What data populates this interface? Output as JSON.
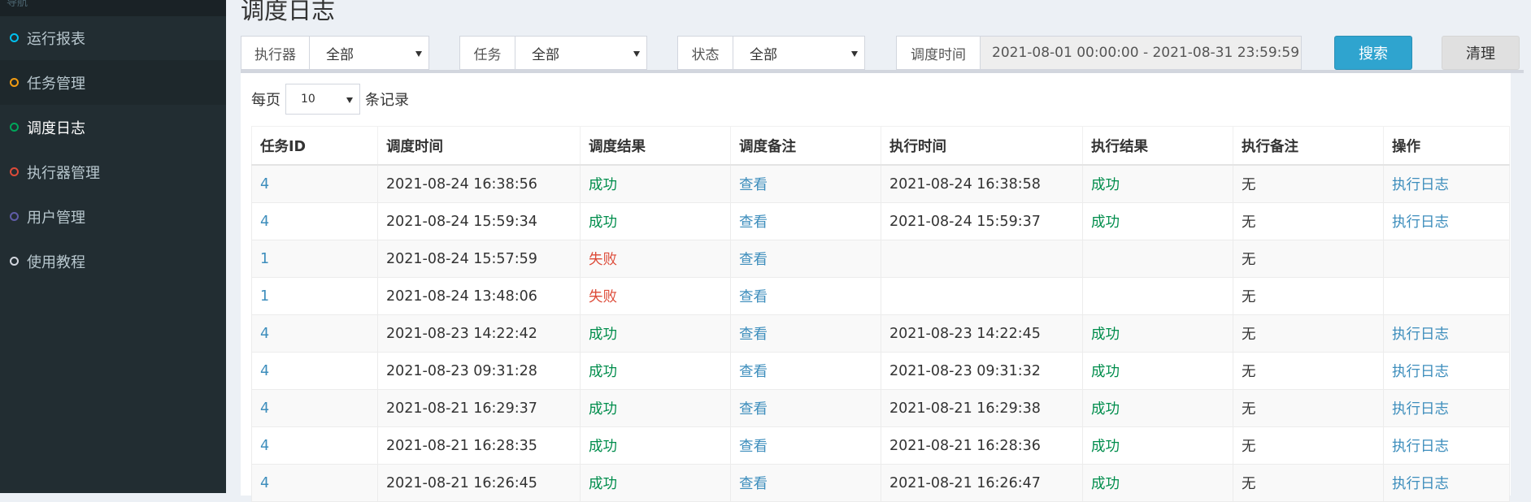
{
  "sidebar": {
    "top_label": "导航",
    "items": [
      {
        "label": "运行报表",
        "color": "#00c0ef"
      },
      {
        "label": "任务管理",
        "color": "#f39c12"
      },
      {
        "label": "调度日志",
        "color": "#00a65a"
      },
      {
        "label": "执行器管理",
        "color": "#dd4b39"
      },
      {
        "label": "用户管理",
        "color": "#605ca8"
      },
      {
        "label": "使用教程",
        "color": "#d2d6de"
      }
    ]
  },
  "page": {
    "title": "调度日志"
  },
  "filters": {
    "executor": {
      "label": "执行器",
      "value": "全部"
    },
    "task": {
      "label": "任务",
      "value": "全部"
    },
    "status": {
      "label": "状态",
      "value": "全部"
    },
    "time": {
      "label": "调度时间",
      "value": "2021-08-01 00:00:00 - 2021-08-31 23:59:59"
    },
    "search_label": "搜索",
    "clear_label": "清理"
  },
  "per_page": {
    "prefix": "每页",
    "value": "10",
    "suffix": "条记录"
  },
  "table": {
    "headers": [
      "任务ID",
      "调度时间",
      "调度结果",
      "调度备注",
      "执行时间",
      "执行结果",
      "执行备注",
      "操作"
    ],
    "rows": [
      [
        "4",
        "2021-08-24 16:38:56",
        "成功",
        "查看",
        "2021-08-24 16:38:58",
        "成功",
        "无",
        "执行日志"
      ],
      [
        "4",
        "2021-08-24 15:59:34",
        "成功",
        "查看",
        "2021-08-24 15:59:37",
        "成功",
        "无",
        "执行日志"
      ],
      [
        "1",
        "2021-08-24 15:57:59",
        "失败",
        "查看",
        "",
        "",
        "无",
        ""
      ],
      [
        "1",
        "2021-08-24 13:48:06",
        "失败",
        "查看",
        "",
        "",
        "无",
        ""
      ],
      [
        "4",
        "2021-08-23 14:22:42",
        "成功",
        "查看",
        "2021-08-23 14:22:45",
        "成功",
        "无",
        "执行日志"
      ],
      [
        "4",
        "2021-08-23 09:31:28",
        "成功",
        "查看",
        "2021-08-23 09:31:32",
        "成功",
        "无",
        "执行日志"
      ],
      [
        "4",
        "2021-08-21 16:29:37",
        "成功",
        "查看",
        "2021-08-21 16:29:38",
        "成功",
        "无",
        "执行日志"
      ],
      [
        "4",
        "2021-08-21 16:28:35",
        "成功",
        "查看",
        "2021-08-21 16:28:36",
        "成功",
        "无",
        "执行日志"
      ],
      [
        "4",
        "2021-08-21 16:26:45",
        "成功",
        "查看",
        "2021-08-21 16:26:47",
        "成功",
        "无",
        "执行日志"
      ]
    ]
  }
}
